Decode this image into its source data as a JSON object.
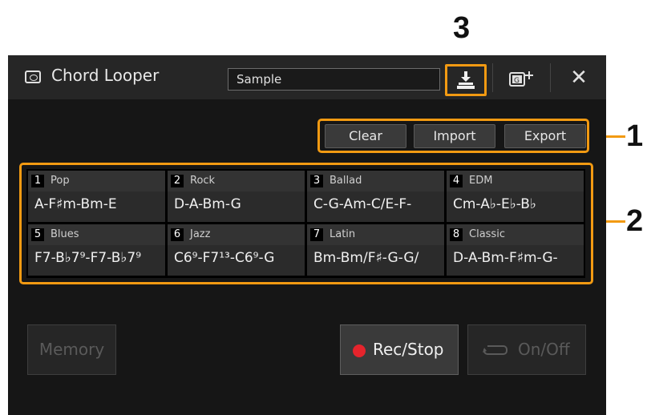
{
  "callouts": {
    "c3": "3",
    "c1": "1",
    "c2": "2"
  },
  "titlebar": {
    "title": "Chord Looper",
    "name_field": "Sample",
    "save_icon": "save-icon",
    "add_icon_text": "G",
    "close_glyph": "✕"
  },
  "actions": {
    "clear": "Clear",
    "import": "Import",
    "export": "Export"
  },
  "chord_slots": [
    {
      "num": "1",
      "name": "Pop",
      "chords": "A-F♯m-Bm-E"
    },
    {
      "num": "2",
      "name": "Rock",
      "chords": "D-A-Bm-G"
    },
    {
      "num": "3",
      "name": "Ballad",
      "chords": "C-G-Am-C/E-F-"
    },
    {
      "num": "4",
      "name": "EDM",
      "chords": "Cm-A♭-E♭-B♭"
    },
    {
      "num": "5",
      "name": "Blues",
      "chords": "F7-B♭7⁹-F7-B♭7⁹"
    },
    {
      "num": "6",
      "name": "Jazz",
      "chords": "C6⁹-F7¹³-C6⁹-G"
    },
    {
      "num": "7",
      "name": "Latin",
      "chords": "Bm-Bm/F♯-G-G/"
    },
    {
      "num": "8",
      "name": "Classic",
      "chords": "D-A-Bm-F♯m-G-"
    }
  ],
  "bottom": {
    "memory": "Memory",
    "rec_stop": "Rec/Stop",
    "on_off": "On/Off"
  },
  "colors": {
    "highlight": "#f29a12",
    "record": "#e5242c"
  }
}
